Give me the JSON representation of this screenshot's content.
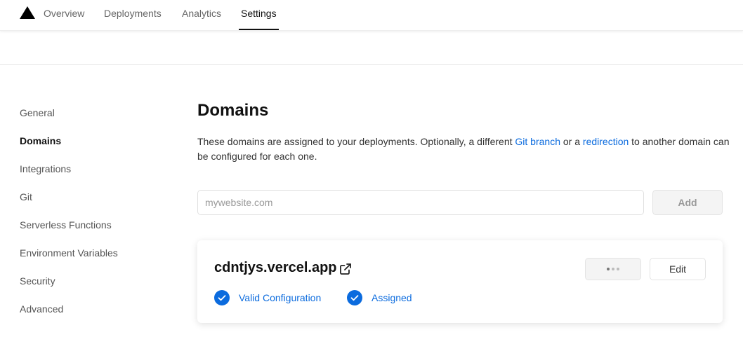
{
  "nav": {
    "logo_icon": "vercel-triangle-icon",
    "tabs": [
      {
        "label": "Overview",
        "active": false
      },
      {
        "label": "Deployments",
        "active": false
      },
      {
        "label": "Analytics",
        "active": false
      },
      {
        "label": "Settings",
        "active": true
      }
    ]
  },
  "sidebar": {
    "items": [
      {
        "label": "General",
        "active": false
      },
      {
        "label": "Domains",
        "active": true
      },
      {
        "label": "Integrations",
        "active": false
      },
      {
        "label": "Git",
        "active": false
      },
      {
        "label": "Serverless Functions",
        "active": false
      },
      {
        "label": "Environment Variables",
        "active": false
      },
      {
        "label": "Security",
        "active": false
      },
      {
        "label": "Advanced",
        "active": false
      }
    ]
  },
  "main": {
    "title": "Domains",
    "description": {
      "part1": "These domains are assigned to your deployments. Optionally, a different ",
      "link1": "Git branch",
      "part2": " or a ",
      "link2": "redirection",
      "part3": " to another domain can be configured for each one."
    },
    "input": {
      "placeholder": "mywebsite.com",
      "value": ""
    },
    "add_label": "Add",
    "domain": {
      "name": "cdntjys.vercel.app",
      "external_icon": "external-link-icon",
      "statuses": [
        {
          "label": "Valid Configuration",
          "icon": "check-circle-icon"
        },
        {
          "label": "Assigned",
          "icon": "check-circle-icon"
        }
      ],
      "more_icon": "more-dots-icon",
      "edit_label": "Edit"
    }
  },
  "colors": {
    "accent": "#0b6bde",
    "text": "#111111",
    "muted": "#666666"
  }
}
